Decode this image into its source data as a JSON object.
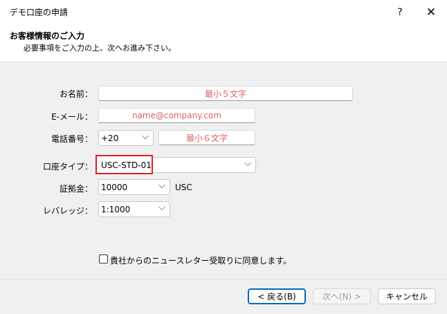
{
  "window": {
    "title": "デモ口座の申請",
    "help_icon": "?",
    "close_icon": "✕"
  },
  "header": {
    "title": "お客様情報のご入力",
    "subtitle": "必要事項をご入力の上、次へお進み下さい。"
  },
  "form": {
    "name": {
      "label": "お名前：",
      "placeholder": "最小５文字"
    },
    "email": {
      "label": "E-メール：",
      "placeholder": "name@company.com"
    },
    "phone": {
      "label": "電話番号：",
      "country_code": "+20",
      "placeholder": "最小６文字"
    },
    "account_type": {
      "label": "口座タイプ：",
      "value": "USC-STD-01"
    },
    "deposit": {
      "label": "証拠金：",
      "value": "10000",
      "currency": "USC"
    },
    "leverage": {
      "label": "レバレッジ：",
      "value": "1:1000"
    },
    "newsletter": {
      "label": "貴社からのニュースレター受取りに同意します。",
      "checked": false
    }
  },
  "buttons": {
    "back": "< 戻る(B)",
    "next": "次へ(N) >",
    "cancel": "キャンセル"
  },
  "colors": {
    "placeholder": "#e06060",
    "highlight_border": "#e02020",
    "primary_border": "#0067c0"
  }
}
